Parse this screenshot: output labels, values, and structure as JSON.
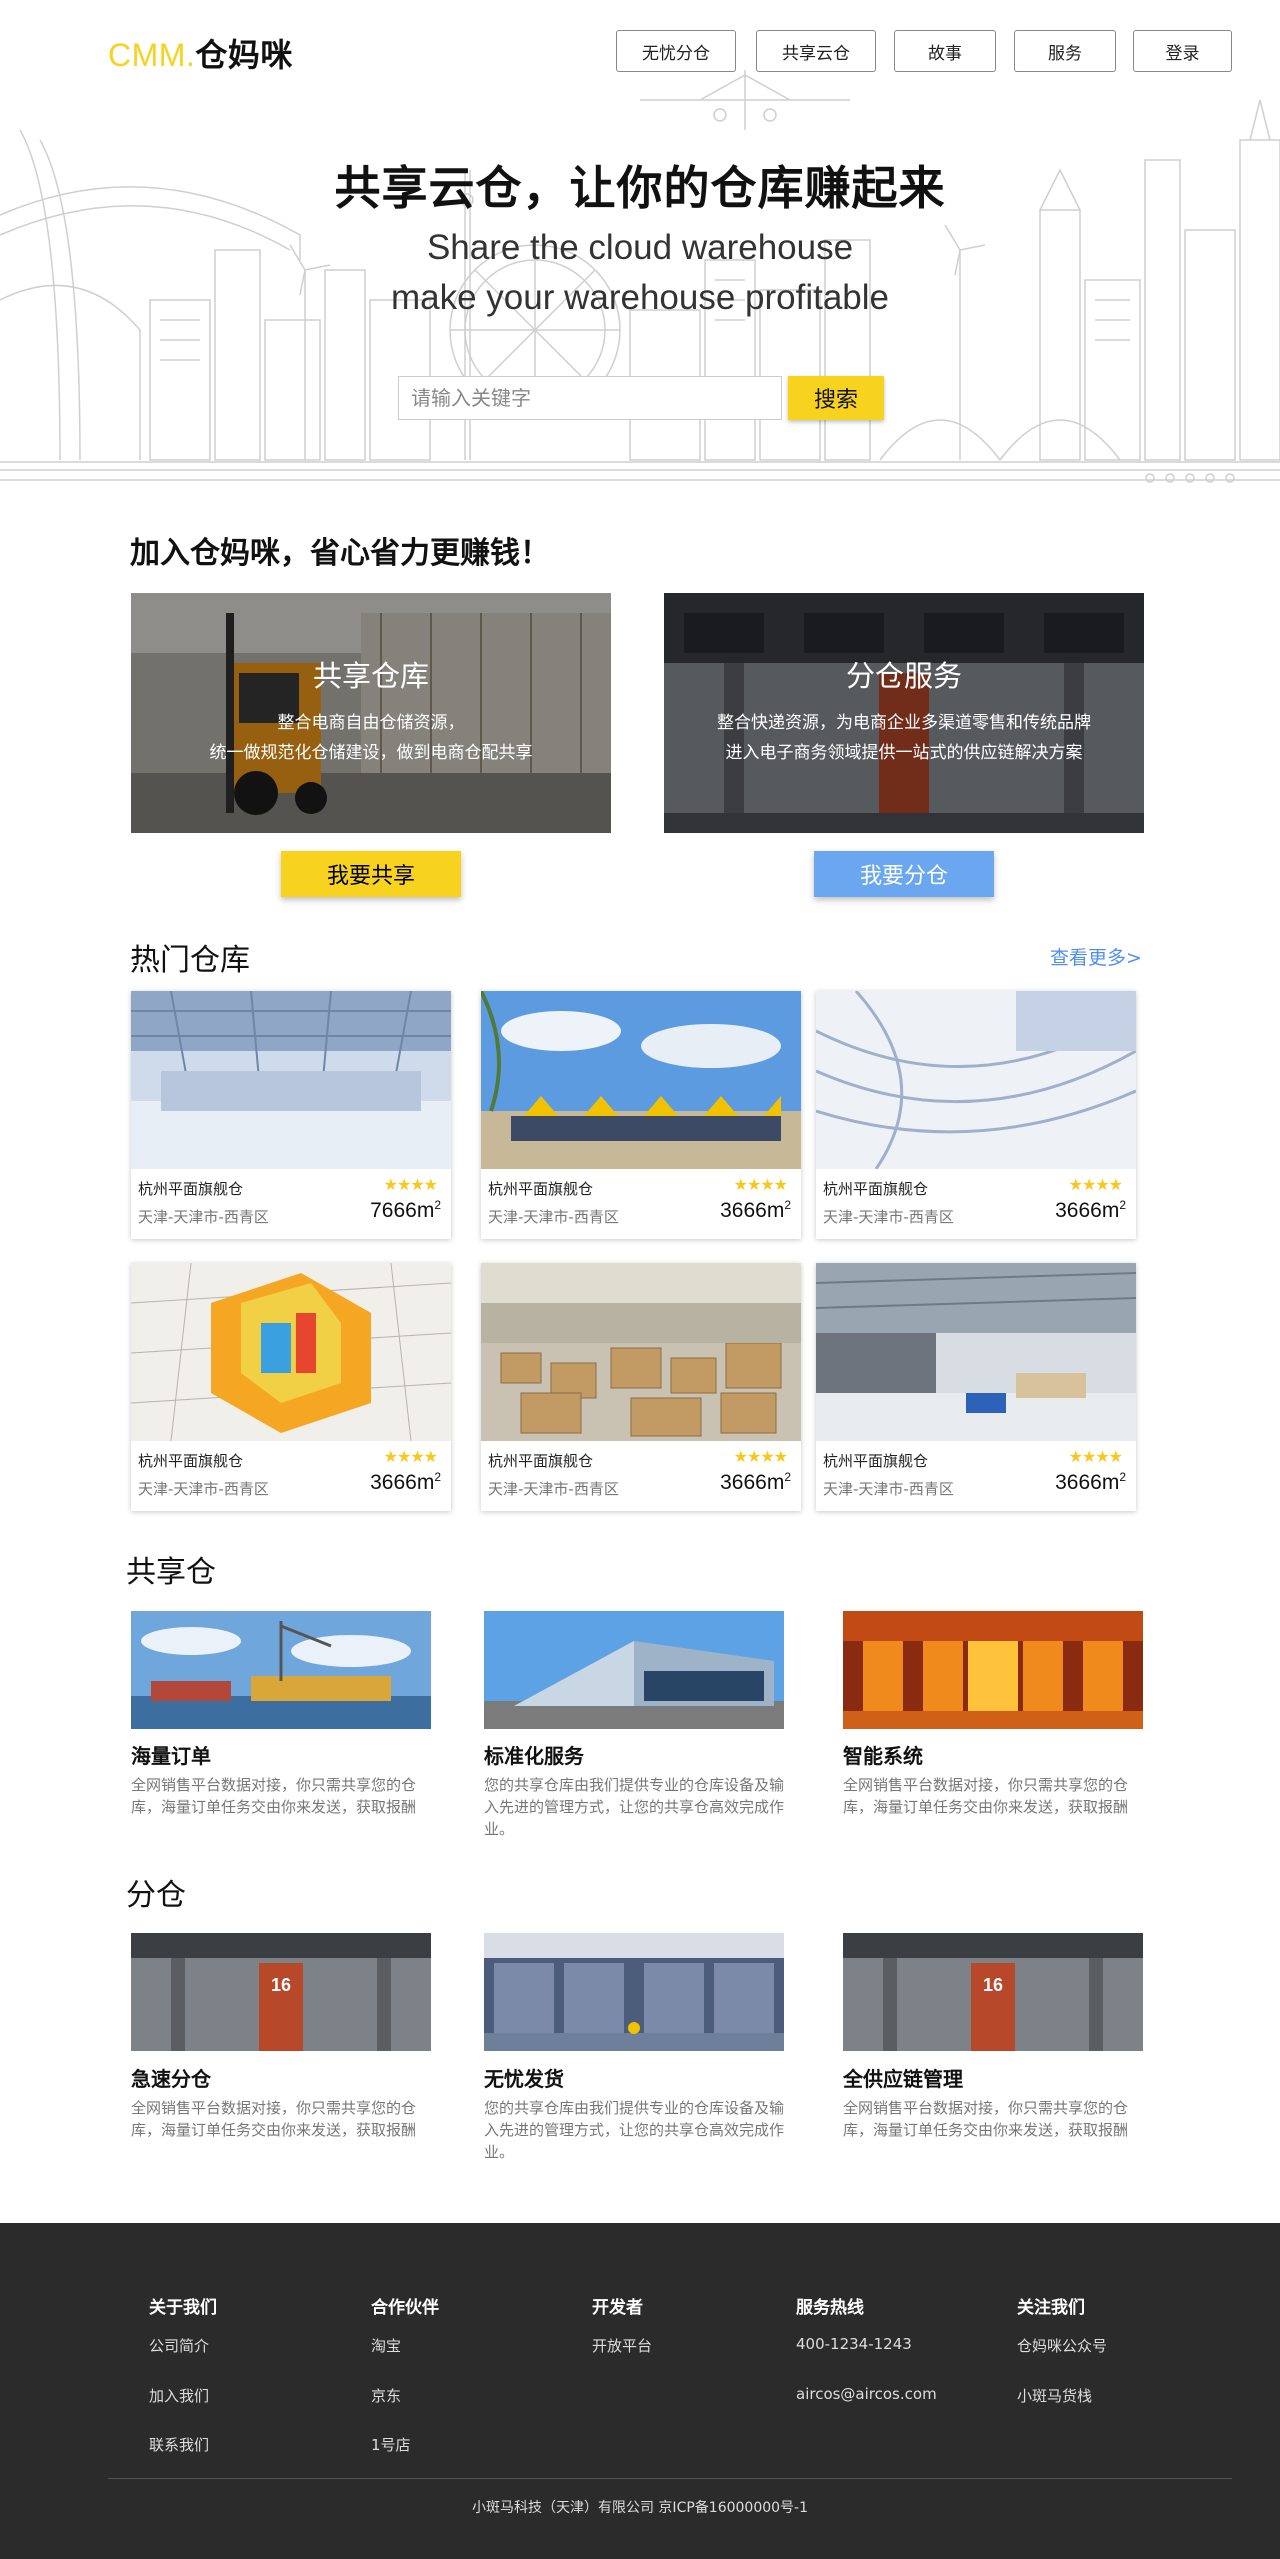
{
  "brand": {
    "en": "CMM.",
    "cn": "仓妈咪"
  },
  "nav": [
    {
      "label": "无忧分仓"
    },
    {
      "label": "共享云仓"
    },
    {
      "label": "故事"
    },
    {
      "label": "服务"
    },
    {
      "label": "登录"
    }
  ],
  "hero": {
    "title": "共享云仓，让你的仓库赚起来",
    "subtitle_line1": "Share the cloud warehouse",
    "subtitle_line2": "make your warehouse profitable",
    "search_placeholder": "请输入关键字",
    "search_button": "搜索"
  },
  "join": {
    "title": "加入仓妈咪，省心省力更赚钱！",
    "cards": [
      {
        "title": "共享仓库",
        "line1": "整合电商自由仓储资源，",
        "line2": "统一做规范化仓储建设，做到电商仓配共享",
        "button": "我要共享",
        "button_color": "#f7d21e"
      },
      {
        "title": "分仓服务",
        "line1": "整合快递资源，为电商企业多渠道零售和传统品牌",
        "line2": "进入电子商务领域提供一站式的供应链解决方案",
        "button": "我要分仓",
        "button_color": "#6aa7f0"
      }
    ]
  },
  "hot": {
    "title": "热门仓库",
    "more": "查看更多>",
    "unit": "m",
    "unit_sup": "2",
    "stars": "★★★★",
    "items": [
      {
        "name": "杭州平面旗舰仓",
        "location": "天津-天津市-西青区",
        "area": "7666"
      },
      {
        "name": "杭州平面旗舰仓",
        "location": "天津-天津市-西青区",
        "area": "3666"
      },
      {
        "name": "杭州平面旗舰仓",
        "location": "天津-天津市-西青区",
        "area": "3666"
      },
      {
        "name": "杭州平面旗舰仓",
        "location": "天津-天津市-西青区",
        "area": "3666"
      },
      {
        "name": "杭州平面旗舰仓",
        "location": "天津-天津市-西青区",
        "area": "3666"
      },
      {
        "name": "杭州平面旗舰仓",
        "location": "天津-天津市-西青区",
        "area": "3666"
      }
    ]
  },
  "shared": {
    "title": "共享仓",
    "items": [
      {
        "title": "海量订单",
        "desc": "全网销售平台数据对接，你只需共享您的仓库，海量订单任务交由你来发送，获取报酬"
      },
      {
        "title": "标准化服务",
        "desc": "您的共享仓库由我们提供专业的仓库设备及输入先进的管理方式，让您的共享仓高效完成作业。"
      },
      {
        "title": "智能系统",
        "desc": "全网销售平台数据对接，你只需共享您的仓库，海量订单任务交由你来发送，获取报酬"
      }
    ]
  },
  "branch": {
    "title": "分仓",
    "door_number": "16",
    "items": [
      {
        "title": "急速分仓",
        "desc": "全网销售平台数据对接，你只需共享您的仓库，海量订单任务交由你来发送，获取报酬"
      },
      {
        "title": "无忧发货",
        "desc": "您的共享仓库由我们提供专业的仓库设备及输入先进的管理方式，让您的共享仓高效完成作业。"
      },
      {
        "title": "全供应链管理",
        "desc": "全网销售平台数据对接，你只需共享您的仓库，海量订单任务交由你来发送，获取报酬"
      }
    ]
  },
  "footer": {
    "columns": [
      {
        "head": "关于我们",
        "links": [
          "公司简介",
          "加入我们",
          "联系我们"
        ]
      },
      {
        "head": "合作伙伴",
        "links": [
          "淘宝",
          "京东",
          "1号店"
        ]
      },
      {
        "head": "开发者",
        "links": [
          "开放平台"
        ]
      },
      {
        "head": "服务热线",
        "links": [
          "400-1234-1243",
          "aircos@aircos.com"
        ]
      },
      {
        "head": "关注我们",
        "links": [
          "仓妈咪公众号",
          "小斑马货栈"
        ]
      }
    ],
    "copyright": "小斑马科技（天津）有限公司 京ICP备16000000号-1"
  }
}
